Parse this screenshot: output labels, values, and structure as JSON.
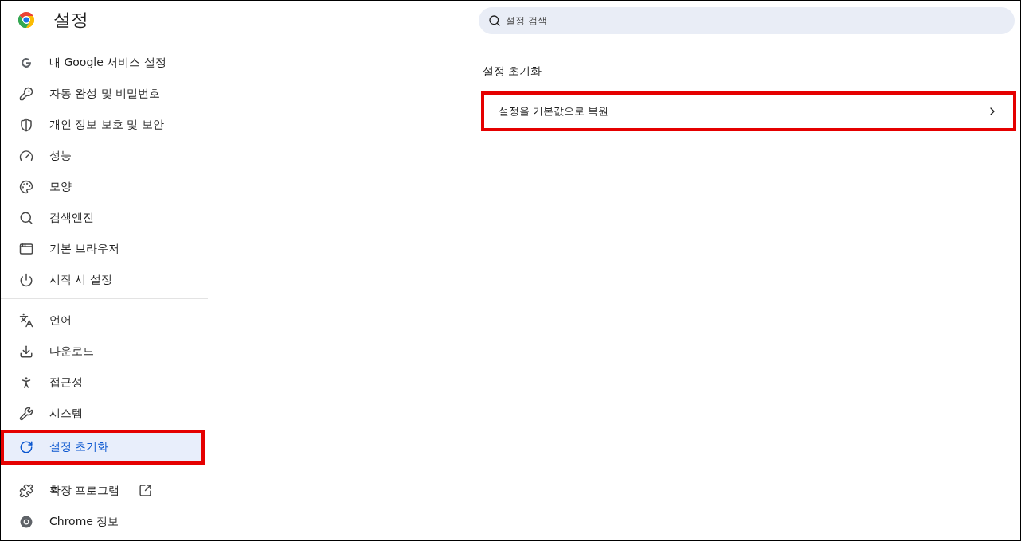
{
  "app": {
    "title": "설정"
  },
  "search": {
    "placeholder": "설정 검색"
  },
  "sidebar": {
    "groups": [
      {
        "items": [
          {
            "kind": "google",
            "label": "내 Google 서비스 설정",
            "selected": false,
            "highlighted": false,
            "external": false
          },
          {
            "kind": "key",
            "label": "자동 완성 및 비밀번호",
            "selected": false,
            "highlighted": false,
            "external": false
          },
          {
            "kind": "shield",
            "label": "개인 정보 보호 및 보안",
            "selected": false,
            "highlighted": false,
            "external": false
          },
          {
            "kind": "gauge",
            "label": "성능",
            "selected": false,
            "highlighted": false,
            "external": false
          },
          {
            "kind": "palette",
            "label": "모양",
            "selected": false,
            "highlighted": false,
            "external": false
          },
          {
            "kind": "search",
            "label": "검색엔진",
            "selected": false,
            "highlighted": false,
            "external": false
          },
          {
            "kind": "window",
            "label": "기본 브라우저",
            "selected": false,
            "highlighted": false,
            "external": false
          },
          {
            "kind": "power",
            "label": "시작 시 설정",
            "selected": false,
            "highlighted": false,
            "external": false
          }
        ]
      },
      {
        "items": [
          {
            "kind": "language",
            "label": "언어",
            "selected": false,
            "highlighted": false,
            "external": false
          },
          {
            "kind": "download",
            "label": "다운로드",
            "selected": false,
            "highlighted": false,
            "external": false
          },
          {
            "kind": "accessibility",
            "label": "접근성",
            "selected": false,
            "highlighted": false,
            "external": false
          },
          {
            "kind": "wrench",
            "label": "시스템",
            "selected": false,
            "highlighted": false,
            "external": false
          },
          {
            "kind": "reset",
            "label": "설정 초기화",
            "selected": true,
            "highlighted": true,
            "external": false
          }
        ]
      },
      {
        "items": [
          {
            "kind": "puzzle",
            "label": "확장 프로그램",
            "selected": false,
            "highlighted": false,
            "external": true
          },
          {
            "kind": "chrome",
            "label": "Chrome 정보",
            "selected": false,
            "highlighted": false,
            "external": false
          }
        ]
      }
    ]
  },
  "section": {
    "title": "설정 초기화",
    "rows": [
      {
        "label": "설정을 기본값으로 복원",
        "highlighted": true
      }
    ]
  }
}
